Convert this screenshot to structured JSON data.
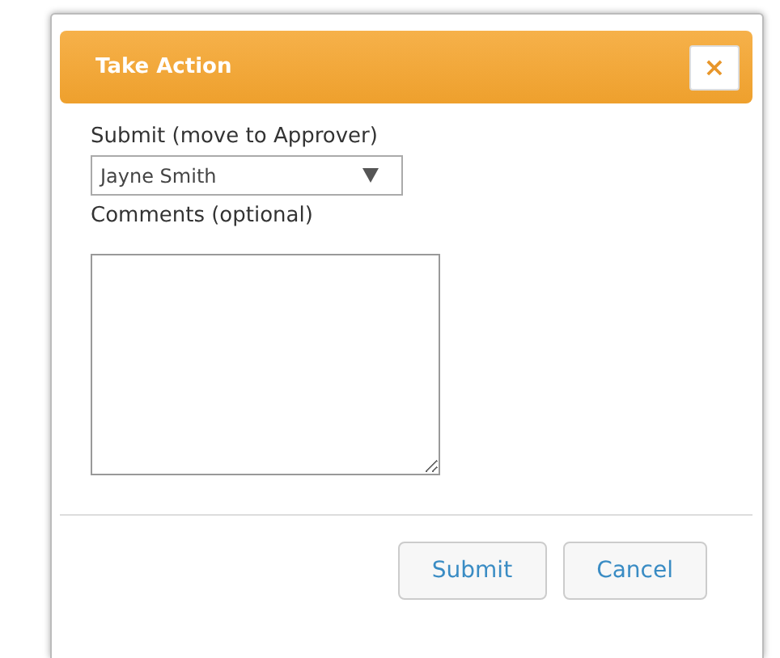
{
  "dialog": {
    "title": "Take Action",
    "close": "×"
  },
  "assignee": {
    "label": "Submit (move to Approver)",
    "value": "Jayne Smith"
  },
  "comments": {
    "label": "Comments (optional)"
  },
  "buttons": [
    {
      "label": "Submit"
    },
    {
      "label": "Cancel"
    }
  ]
}
